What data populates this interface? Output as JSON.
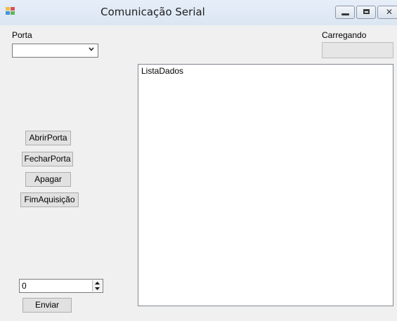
{
  "window": {
    "title": "Comunicação Serial"
  },
  "porta": {
    "label": "Porta",
    "selected_value": ""
  },
  "carregando": {
    "label": "Carregando",
    "progress": 0
  },
  "lista_dados": {
    "items": [
      "ListaDados"
    ]
  },
  "buttons": {
    "abrir_porta": "AbrirPorta",
    "fechar_porta": "FecharPorta",
    "apagar": "Apagar",
    "fim_aquisicao": "FimAquisição",
    "enviar": "Enviar"
  },
  "numeric": {
    "value": "0"
  },
  "icons": {
    "app": "app-icon",
    "minimize": "minimize-icon",
    "maximize": "maximize-icon",
    "close": "close-icon",
    "dropdown": "chevron-down-icon",
    "spin_up": "arrow-up-icon",
    "spin_down": "arrow-down-icon"
  },
  "colors": {
    "titlebar": "#dbe6f3",
    "window_bg": "#f0f0f0",
    "progress_fill": "#06b025"
  }
}
